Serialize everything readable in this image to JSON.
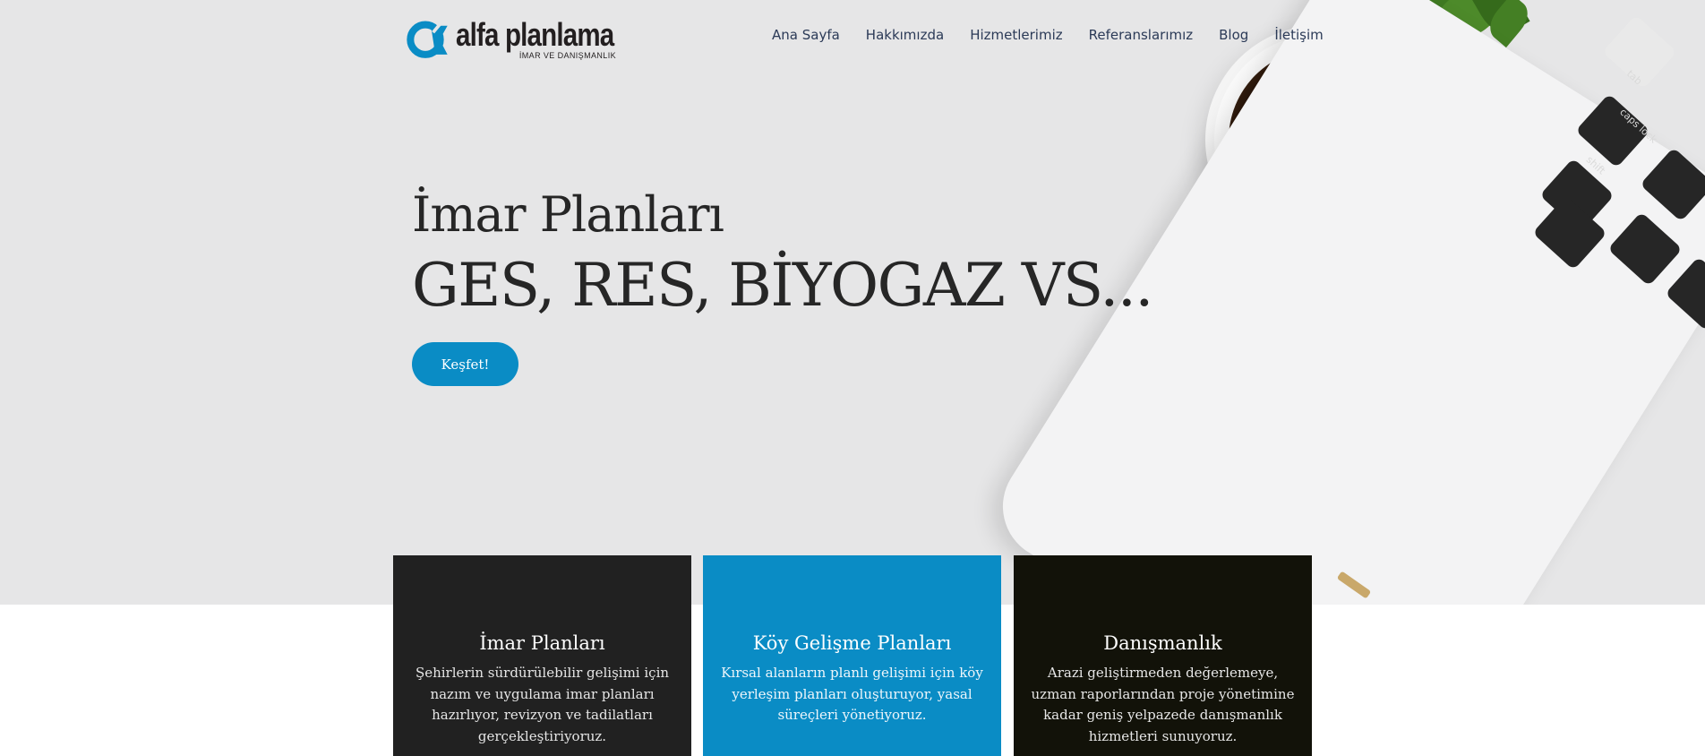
{
  "brand": {
    "name": "alfa planlama",
    "tagline": "İMAR VE DANIŞMANLIK",
    "accent_color": "#0a8cc5"
  },
  "nav": {
    "items": [
      {
        "label": "Ana Sayfa"
      },
      {
        "label": "Hakkımızda"
      },
      {
        "label": "Hizmetlerimiz"
      },
      {
        "label": "Referanslarımız"
      },
      {
        "label": "Blog"
      },
      {
        "label": "İletişim"
      }
    ]
  },
  "hero": {
    "title": "İmar Planları",
    "subtitle": "GES, RES, BİYOGAZ VS...",
    "cta_label": "Keşfet!",
    "background_image": "desk-with-coffee-plant-laptop"
  },
  "laptop_keys": {
    "tab": "tab",
    "caps": "caps lock",
    "shift": "shift"
  },
  "cards": [
    {
      "title": "İmar Planları",
      "text": "Şehirlerin sürdürülebilir gelişimi için nazım ve uygulama imar planları hazırlıyor, revizyon ve tadilatları gerçekleştiriyoruz.",
      "bg_color": "#212121"
    },
    {
      "title": "Köy Gelişme Planları",
      "text": "Kırsal alanların planlı gelişimi için köy yerleşim planları oluşturuyor, yasal süreçleri yönetiyoruz.",
      "bg_color": "#0a8cc5"
    },
    {
      "title": "Danışmanlık",
      "text": "Arazi geliştirmeden değerlemeye, uzman raporlarından proje yönetimine kadar geniş yelpazede danışmanlık hizmetleri sunuyoruz.",
      "bg_color": "#121209"
    }
  ]
}
